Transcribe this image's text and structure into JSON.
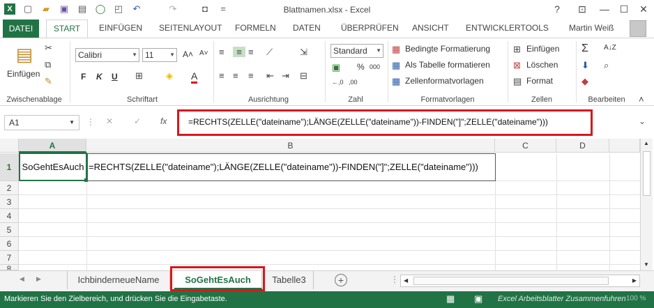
{
  "window": {
    "title": "Blattnamen.xlsx - Excel",
    "help": "?",
    "minimize": "—",
    "maximize": "☐",
    "close": "✕"
  },
  "quick_access": {
    "app_icon": "X",
    "undo_icon": "↶",
    "redo_icon": "↷",
    "more": "="
  },
  "tabs": {
    "file": "DATEI",
    "items": [
      "START",
      "EINFÜGEN",
      "SEITENLAYOUT",
      "FORMELN",
      "DATEN",
      "ÜBERPRÜFEN",
      "ANSICHT",
      "ENTWICKLERTOOLS"
    ],
    "user": "Martin Weiß"
  },
  "ribbon": {
    "clipboard": {
      "paste": "Einfügen",
      "label": "Zwischenablage"
    },
    "font": {
      "name": "Calibri",
      "size": "11",
      "bold": "F",
      "italic": "K",
      "underline": "U",
      "grow": "A˄",
      "shrink": "A˅",
      "color": "A",
      "label": "Schriftart"
    },
    "alignment": {
      "label": "Ausrichtung"
    },
    "number": {
      "format": "Standard",
      "percent": "%",
      "thousands": "000",
      "dec_inc": "←,0",
      "dec_dec": ",00",
      "label": "Zahl"
    },
    "styles": {
      "conditional": "Bedingte Formatierung",
      "as_table": "Als Tabelle formatieren",
      "cell_styles": "Zellenformatvorlagen",
      "label": "Formatvorlagen"
    },
    "cells": {
      "insert": "Einfügen",
      "delete": "Löschen",
      "format": "Format",
      "label": "Zellen"
    },
    "editing": {
      "sum": "Σ",
      "sort": "A↓Z",
      "label": "Bearbeiten"
    }
  },
  "formula_bar": {
    "name_box": "A1",
    "fx": "fx",
    "formula": "=RECHTS(ZELLE(\"dateiname\");LÄNGE(ZELLE(\"dateiname\"))-FINDEN(\"]\";ZELLE(\"dateiname\")))"
  },
  "grid": {
    "columns": [
      "A",
      "B",
      "C",
      "D"
    ],
    "rows": [
      "1",
      "2",
      "3",
      "4",
      "5",
      "6",
      "7",
      "8"
    ],
    "a1": "SoGehtEsAuch",
    "b1": "=RECHTS(ZELLE(\"dateiname\");LÄNGE(ZELLE(\"dateiname\"))-FINDEN(\"]\";ZELLE(\"dateiname\")))"
  },
  "sheets": {
    "tabs": [
      "IchbinderneueName",
      "SoGehtEsAuch",
      "Tabelle3"
    ],
    "active": "SoGehtEsAuch",
    "add": "+",
    "dots": "⋮"
  },
  "status": {
    "message": "Markieren Sie den Zielbereich, und drücken Sie die Eingabetaste.",
    "watermark": "Excel Arbeitsblatter Zusammenfuhren",
    "zoom": "100 %"
  },
  "colors": {
    "accent": "#217346",
    "highlight": "#d9171b"
  }
}
